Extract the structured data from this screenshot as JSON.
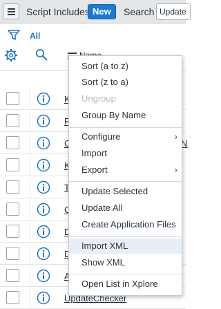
{
  "header": {
    "title": "Script Includes",
    "new_label": "New",
    "search_label": "Search",
    "search_value": "Update"
  },
  "filter": {
    "all_label": "All"
  },
  "column": {
    "name_label": "Name"
  },
  "rows": [
    {
      "name": "K"
    },
    {
      "name": "R"
    },
    {
      "name": "C",
      "tail": "N"
    },
    {
      "name": "K"
    },
    {
      "name": "T"
    },
    {
      "name": "C"
    },
    {
      "name": "D"
    },
    {
      "name": "D"
    },
    {
      "name": "A"
    },
    {
      "name": "UpdateChecker"
    }
  ],
  "context_menu": {
    "sort_az": "Sort (a to z)",
    "sort_za": "Sort (z to a)",
    "ungroup": "Ungroup",
    "group_by_name": "Group By Name",
    "configure": "Configure",
    "import": "Import",
    "export": "Export",
    "update_selected": "Update Selected",
    "update_all": "Update All",
    "create_app_files": "Create Application Files",
    "import_xml": "Import XML",
    "show_xml": "Show XML",
    "open_xplore": "Open List in Xplore"
  },
  "colors": {
    "accent": "#1d78d1",
    "header_bg": "#e4e6e7",
    "menu_highlight": "#e6eef7"
  }
}
